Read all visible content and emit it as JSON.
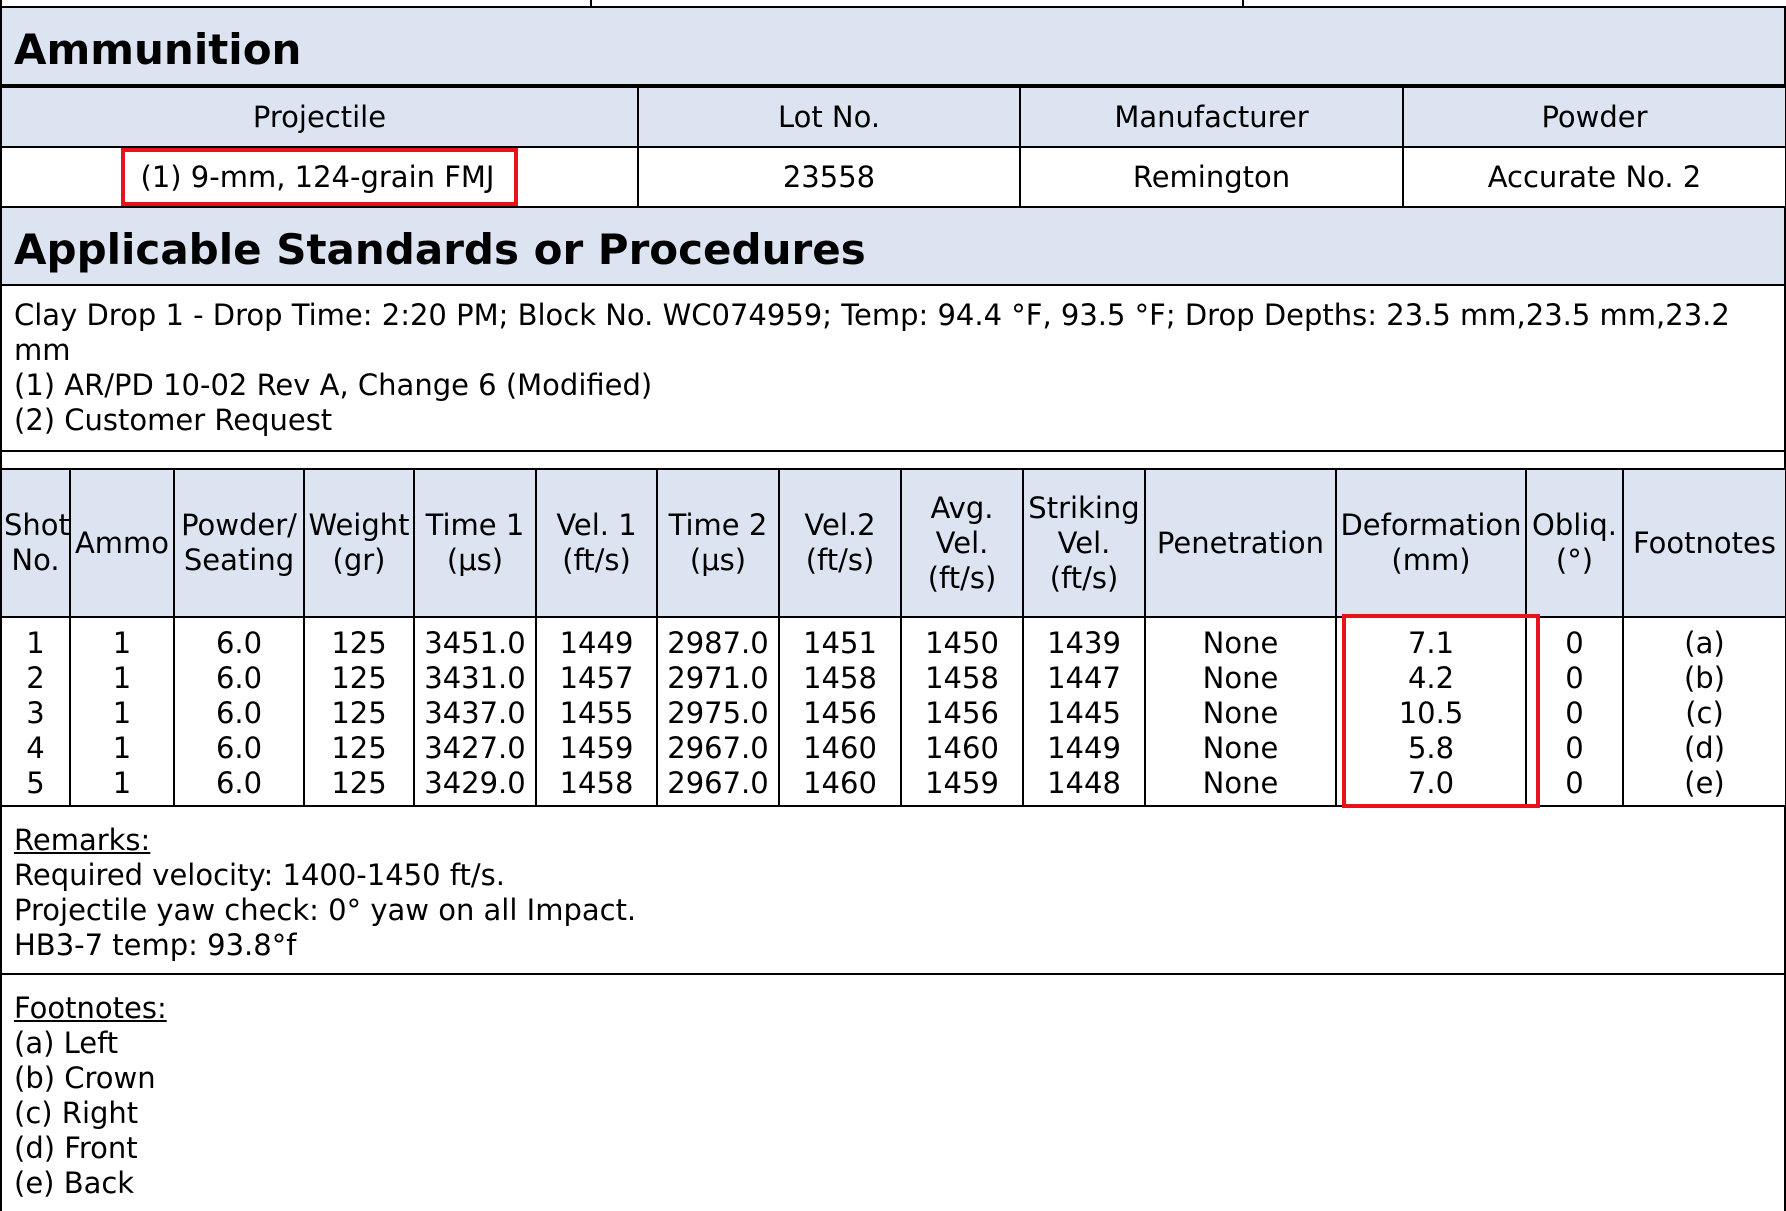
{
  "ammunition": {
    "title": "Ammunition",
    "headers": [
      "Projectile",
      "Lot No.",
      "Manufacturer",
      "Powder"
    ],
    "projectile": "(1) 9-mm, 124-grain FMJ",
    "lot": "23558",
    "manufacturer": "Remington",
    "powder": "Accurate No. 2"
  },
  "standards": {
    "title": "Applicable Standards or Procedures",
    "lines": [
      "Clay Drop 1 - Drop Time: 2:20 PM; Block No. WC074959; Temp: 94.4 °F, 93.5 °F; Drop Depths: 23.5 mm,23.5 mm,23.2 mm",
      "(1) AR/PD 10-02 Rev A, Change 6 (Modified)",
      "(2) Customer Request"
    ]
  },
  "shots": {
    "headers": [
      [
        "Shot",
        "No."
      ],
      [
        "Ammo"
      ],
      [
        "Powder/",
        "Seating"
      ],
      [
        "Weight",
        "(gr)"
      ],
      [
        "Time 1",
        "(μs)"
      ],
      [
        "Vel. 1",
        "(ft/s)"
      ],
      [
        "Time 2",
        "(μs)"
      ],
      [
        "Vel.2",
        "(ft/s)"
      ],
      [
        "Avg.",
        "Vel.",
        "(ft/s)"
      ],
      [
        "Striking",
        "Vel.",
        "(ft/s)"
      ],
      [
        "Penetration"
      ],
      [
        "Deformation",
        "(mm)"
      ],
      [
        "Obliq.",
        "(°)"
      ],
      [
        "Footnotes"
      ]
    ],
    "rows": [
      [
        "1",
        "1",
        "6.0",
        "125",
        "3451.0",
        "1449",
        "2987.0",
        "1451",
        "1450",
        "1439",
        "None",
        "7.1",
        "0",
        "(a)"
      ],
      [
        "2",
        "1",
        "6.0",
        "125",
        "3431.0",
        "1457",
        "2971.0",
        "1458",
        "1458",
        "1447",
        "None",
        "4.2",
        "0",
        "(b)"
      ],
      [
        "3",
        "1",
        "6.0",
        "125",
        "3437.0",
        "1455",
        "2975.0",
        "1456",
        "1456",
        "1445",
        "None",
        "10.5",
        "0",
        "(c)"
      ],
      [
        "4",
        "1",
        "6.0",
        "125",
        "3427.0",
        "1459",
        "2967.0",
        "1460",
        "1460",
        "1449",
        "None",
        "5.8",
        "0",
        "(d)"
      ],
      [
        "5",
        "1",
        "6.0",
        "125",
        "3429.0",
        "1458",
        "2967.0",
        "1460",
        "1459",
        "1448",
        "None",
        "7.0",
        "0",
        "(e)"
      ]
    ]
  },
  "remarks": {
    "label": "Remarks:",
    "lines": [
      "Required velocity: 1400-1450 ft/s.",
      "Projectile yaw check: 0° yaw on all Impact.",
      "HB3-7 temp: 93.8°f"
    ]
  },
  "footnotes": {
    "label": "Footnotes:",
    "lines": [
      "(a) Left",
      "(b) Crown",
      "(c) Right",
      "(d) Front",
      "(e) Back"
    ]
  },
  "colors": {
    "header_fill": "#dce4f2",
    "highlight": "#e8121c"
  }
}
